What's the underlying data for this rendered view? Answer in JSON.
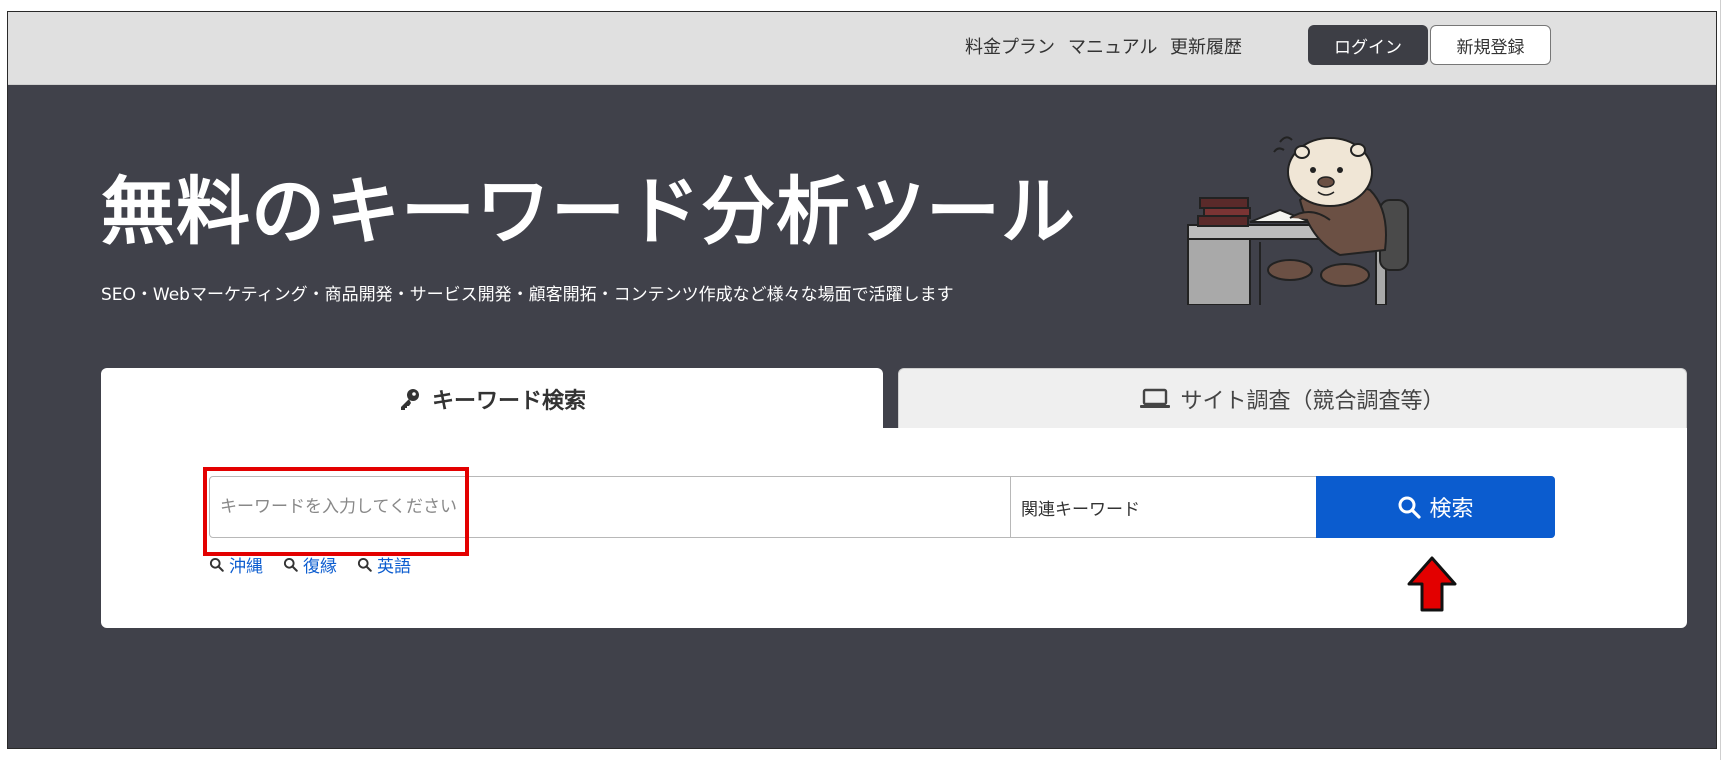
{
  "header": {
    "nav": [
      "料金プラン",
      "マニュアル",
      "更新履歴"
    ],
    "login_label": "ログイン",
    "signup_label": "新規登録"
  },
  "hero": {
    "title": "無料のキーワード分析ツール",
    "subtitle": "SEO・Webマーケティング・商品開発・サービス開発・顧客開拓・コンテンツ作成など様々な場面で活躍します"
  },
  "tabs": [
    {
      "label": "キーワード検索",
      "icon": "key-icon",
      "active": true
    },
    {
      "label": "サイト調査（競合調査等）",
      "icon": "laptop-icon",
      "active": false
    }
  ],
  "search": {
    "placeholder": "キーワードを入力してください",
    "type_value": "関連キーワード",
    "button_label": "検索",
    "suggestions": [
      "沖縄",
      "復縁",
      "英語"
    ]
  },
  "colors": {
    "hero_bg": "#40414a",
    "header_bg": "#e0e0e0",
    "accent": "#0b5ccf",
    "highlight": "#e30000"
  }
}
